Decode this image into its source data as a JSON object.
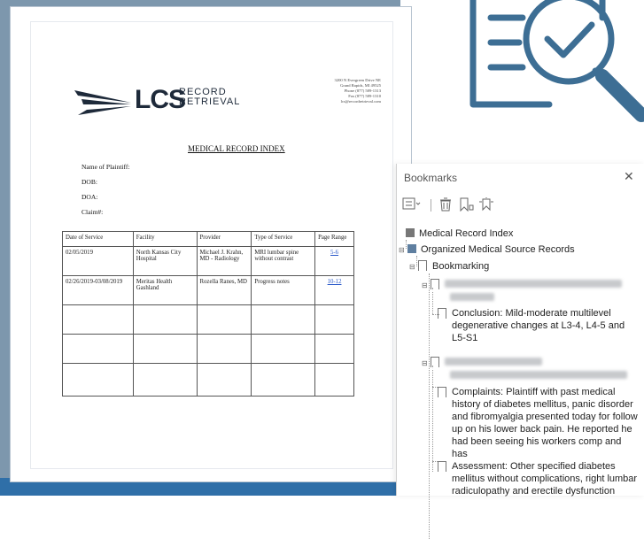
{
  "document": {
    "logo_main": "LCS",
    "logo_line1": "RECORD",
    "logo_line2": "RETRIEVAL",
    "address": [
      "3200 N Evergreen Drive NE",
      "Grand Rapids, MI 49525",
      "Phone (877) 589-1313",
      "Fax (877) 589-1310",
      "lcs@recordretrieval.com"
    ],
    "index_title": "MEDICAL RECORD INDEX",
    "fields": [
      "Name of Plaintiff:",
      "DOB:",
      "DOA:",
      "Claim#:"
    ],
    "table": {
      "headers": [
        "Date of Service",
        "Facility",
        "Provider",
        "Type of Service",
        "Page Range"
      ],
      "rows": [
        [
          "02/05/2019",
          "North Kansas City Hospital",
          "Michael J. Krahn, MD - Radiology",
          "MRI lumbar spine without contrast",
          "5-6"
        ],
        [
          "02/26/2019-03/08/2019",
          "Meritas Health Gashland",
          "Rozella Ranes, MD",
          "Progress notes",
          "10-12"
        ]
      ]
    }
  },
  "bookmarks_panel": {
    "title": "Bookmarks",
    "close_glyph": "✕",
    "items": {
      "medical_record_index": "Medical Record Index",
      "organized_sources": "Organized Medical Source Records",
      "bookmarking": "Bookmarking",
      "conclusion": "Conclusion: Mild-moderate multilevel degenerative changes at L3-4, L4-5 and L5-S1",
      "complaints": "Complaints: Plaintiff with past medical history of diabetes mellitus, panic disorder and fibromyalgia presented today for follow up on his lower back pain. He reported he had been seeing his workers comp and has",
      "assessment": "Assessment: Other specified diabetes mellitus without complications, right lumbar radiculopathy and erectile dysfunction"
    }
  },
  "colors": {
    "background_blue": "#7d97ad",
    "strip_blue": "#2f6fa8",
    "icon_blue": "#3d6e94",
    "link_blue": "#2a59c9"
  },
  "icons": [
    "checklist-magnifier-icon",
    "panel-options-icon",
    "delete-bookmark-icon",
    "new-bookmark-icon",
    "expand-bookmark-icon",
    "close-icon"
  ]
}
